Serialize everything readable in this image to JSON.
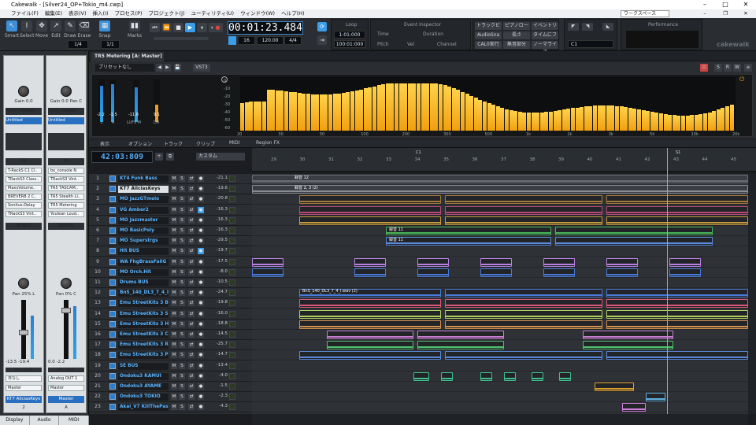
{
  "app": {
    "title": "Cakewalk - [Silver24_OP+Tokio_m4.cwp]"
  },
  "menu": [
    "ファイル(F)",
    "編集(E)",
    "表示(V)",
    "挿入(I)",
    "プロセス(P)",
    "プロジェクト(J)",
    "ユーティリティ(U)",
    "ウィンドウ(W)",
    "ヘルプ(H)"
  ],
  "workspace": "ワークスペース",
  "tools": [
    {
      "label": "Smart"
    },
    {
      "label": "Select"
    },
    {
      "label": "Move"
    },
    {
      "label": "Edit"
    },
    {
      "label": "Draw"
    },
    {
      "label": "Erase"
    }
  ],
  "tool_fraction": "1/4",
  "snap": {
    "label": "Snap",
    "value": "1/1"
  },
  "marks_label": "Marks",
  "transport": {
    "time": "00:01:23.484",
    "tempo": "120.00",
    "meter": "4/4",
    "beats": "16"
  },
  "loop": {
    "label": "Loop",
    "start": "1:01:000",
    "end": "100:01:000"
  },
  "event_inspector": {
    "title": "Event Inspector",
    "fields": [
      "Time",
      "Duration",
      "Pitch",
      "Vel",
      "Channel"
    ]
  },
  "screensets": [
    "トラックビュー",
    "ピアノロー",
    "イベントリ",
    "AudioSna",
    "長さ",
    "タイムにフ",
    "CAL0実行",
    "無音部分",
    "ノーマライズ"
  ],
  "preset_c1": "C1",
  "performance_label": "Performance",
  "brand": "cakewalk",
  "dock_tab": "TR5 Metering [A: Master]",
  "plugin": {
    "preset": "プリセットなし",
    "vst": "VST3",
    "left_read": "-2.2",
    "right_read": "-1.5",
    "lufs_read": "-11.8",
    "lufs_read2": "9.1",
    "lufs_label": "LUFS M",
    "dr_label": "DR",
    "l_label": "L",
    "r_label": "R",
    "spec_ticks": [
      "20",
      "30",
      "50",
      "100",
      "200",
      "300",
      "500",
      "1k",
      "2k",
      "3k",
      "5k",
      "10k",
      "20k"
    ],
    "db_ticks": [
      "0",
      "-10",
      "-20",
      "-30",
      "-40",
      "-50",
      "-60"
    ]
  },
  "trackview": {
    "menus": [
      "表示",
      "オプション",
      "トラック",
      "クリップ",
      "MIDI",
      "Region FX"
    ],
    "now_time": "42:03:809",
    "preset": "カスタム",
    "ruler": [
      "29",
      "30",
      "31",
      "32",
      "33",
      "34",
      "35",
      "36",
      "37",
      "38",
      "39",
      "40",
      "41",
      "42",
      "43",
      "44",
      "45"
    ],
    "markers": [
      "C1",
      "S1"
    ]
  },
  "strips": {
    "left": {
      "gain": "Gain 0.0",
      "prochannel": "PROCHANNEL",
      "preset": "Untitled",
      "fx": [
        "T-RackS C1 Cl..",
        "TRackS3 Class..",
        "MaxxVolume..",
        "BREVERB 2 C..",
        "Sonitus:Delay",
        "TRackS3 Vint.."
      ],
      "pan": "Pan 25% L",
      "io": "IN / OUT",
      "input": "日なし",
      "output": "Master",
      "name": "KT7 AliciasKeys",
      "num": "2",
      "vol": "-13.5",
      "vol2": "-19.4"
    },
    "right": {
      "gain": "Gain 0.0",
      "pan_lbl": "Pan C",
      "prochannel": "PROCHANNEL",
      "preset": "Untitled",
      "fx": [
        "bx_console N",
        "TRackS3 Vint..",
        "TR5 TASCAM..",
        "TR5 Stealth Li..",
        "TR5 Metering",
        "Youlean Loud.."
      ],
      "pan": "Pan 0% C",
      "io": "IN / OUT",
      "input": "Analog OUT 1",
      "output": "Master",
      "name": "Master",
      "num": "A",
      "vol": "0.0",
      "vol2": "-2.2"
    },
    "fx_label": "FX",
    "sends_label": "SENDS"
  },
  "tabs": [
    "Display",
    "Audio",
    "MIDI"
  ],
  "tracks": [
    {
      "n": "1",
      "name": "KT4 Funk Bass",
      "vol": "-21.1"
    },
    {
      "n": "2",
      "name": "KT7 AliciasKeys",
      "vol": "-19.6"
    },
    {
      "n": "3",
      "name": "MO JazzGTmelo",
      "vol": "-20.8"
    },
    {
      "n": "4",
      "name": "VG Amber2",
      "vol": "-16.3"
    },
    {
      "n": "5",
      "name": "MO Jazzmaster",
      "vol": "-16.3"
    },
    {
      "n": "6",
      "name": "MO BasicPoly",
      "vol": "-16.3"
    },
    {
      "n": "7",
      "name": "MO Superstrgs",
      "vol": "-29.5"
    },
    {
      "n": "8",
      "name": "Hit BUS",
      "vol": "-19.7"
    },
    {
      "n": "9",
      "name": "WA FhgBrassFallG",
      "vol": "-17.5"
    },
    {
      "n": "10",
      "name": "MO Orch.Hit",
      "vol": "-8.0"
    },
    {
      "n": "11",
      "name": "Drums BUS",
      "vol": "-10.5"
    },
    {
      "n": "12",
      "name": "BnS_140_DL3_7_4_I",
      "vol": "-24.7"
    },
    {
      "n": "13",
      "name": "Emu StreetKits 3 BD",
      "vol": "-19.8"
    },
    {
      "n": "14",
      "name": "Emu StreetKits 3 SD",
      "vol": "-16.0"
    },
    {
      "n": "15",
      "name": "Emu StreetKits 3 HH",
      "vol": "-18.8"
    },
    {
      "n": "16",
      "name": "Emu StreetKits 3 CC",
      "vol": "-14.5"
    },
    {
      "n": "17",
      "name": "Emu StreetKits 3 Re",
      "vol": "-25.7"
    },
    {
      "n": "18",
      "name": "Emu StreetKits 3 PC",
      "vol": "-14.7"
    },
    {
      "n": "19",
      "name": "SE BUS",
      "vol": "-13.4"
    },
    {
      "n": "20",
      "name": "Ondoku3 KAMUI",
      "vol": "-4.0"
    },
    {
      "n": "21",
      "name": "Ondoku3 AYAME",
      "vol": "-1.5"
    },
    {
      "n": "22",
      "name": "Ondoku3 TOKIO",
      "vol": "-2.3"
    },
    {
      "n": "23",
      "name": "Akai_V7 KillThePast",
      "vol": "-4.3"
    }
  ],
  "clip_labels": {
    "t1": "録音 12",
    "t2": "録音 2, 3 (2)",
    "t6": "録音 11",
    "t7": "録音 11",
    "t12": "BnS_140_DL3_7_4_I.wav (2)"
  },
  "colors": {
    "accent": "#3a9ee8",
    "spectrum": "#f4b420",
    "track_name": "#5ab4ff"
  }
}
